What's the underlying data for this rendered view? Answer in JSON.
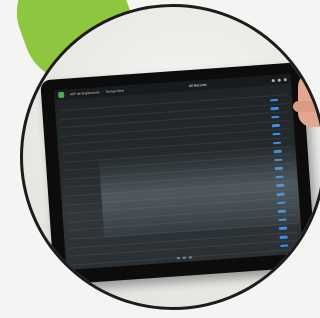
{
  "screen": {
    "topbar": {
      "left_text_1": "APP de EngSemana",
      "left_text_2": "Tiempo Real",
      "title": "All Records"
    },
    "table": {
      "headers": [
        "",
        "",
        "",
        "",
        "",
        "",
        "",
        "",
        ""
      ],
      "rows": [
        [
          "",
          "",
          "",
          "",
          "",
          "",
          "",
          "",
          ""
        ],
        [
          "",
          "",
          "",
          "",
          "",
          "",
          "",
          "",
          ""
        ],
        [
          "",
          "",
          "",
          "",
          "",
          "",
          "",
          "",
          ""
        ],
        [
          "",
          "",
          "",
          "",
          "",
          "",
          "",
          "",
          ""
        ],
        [
          "",
          "",
          "",
          "",
          "",
          "",
          "",
          "",
          ""
        ],
        [
          "",
          "",
          "",
          "",
          "",
          "",
          "",
          "",
          ""
        ],
        [
          "",
          "",
          "",
          "",
          "",
          "",
          "",
          "",
          ""
        ],
        [
          "",
          "",
          "",
          "",
          "",
          "",
          "",
          "",
          ""
        ],
        [
          "",
          "",
          "",
          "",
          "",
          "",
          "",
          "",
          ""
        ],
        [
          "",
          "",
          "",
          "",
          "",
          "",
          "",
          "",
          ""
        ],
        [
          "",
          "",
          "",
          "",
          "",
          "",
          "",
          "",
          ""
        ],
        [
          "",
          "",
          "",
          "",
          "",
          "",
          "",
          "",
          ""
        ],
        [
          "",
          "",
          "",
          "",
          "",
          "",
          "",
          "",
          ""
        ],
        [
          "",
          "",
          "",
          "",
          "",
          "",
          "",
          "",
          ""
        ],
        [
          "",
          "",
          "",
          "",
          "",
          "",
          "",
          "",
          ""
        ],
        [
          "",
          "",
          "",
          "",
          "",
          "",
          "",
          "",
          ""
        ],
        [
          "",
          "",
          "",
          "",
          "",
          "",
          "",
          "",
          ""
        ],
        [
          "",
          "",
          "",
          "",
          "",
          "",
          "",
          "",
          ""
        ]
      ]
    }
  },
  "colors": {
    "accent_green": "#8dc63f",
    "status_blue": "#3f8ee0",
    "screen_bg": "#1f2326"
  }
}
